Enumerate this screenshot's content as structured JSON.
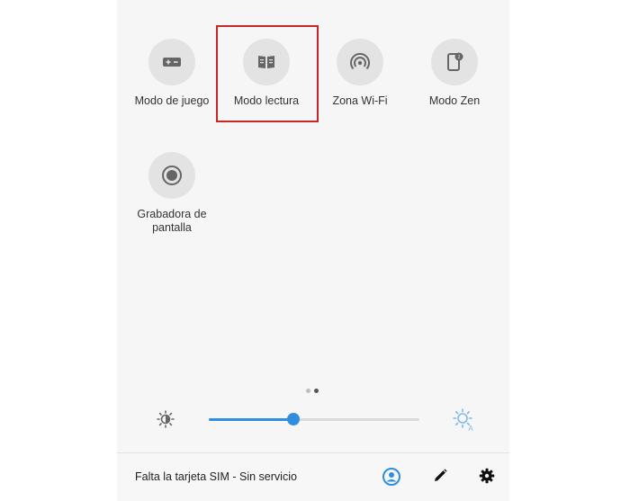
{
  "tiles_row1": [
    {
      "label": "Modo de juego",
      "icon": "gamepad-icon"
    },
    {
      "label": "Modo lectura",
      "icon": "book-icon"
    },
    {
      "label": "Zona Wi-Fi",
      "icon": "hotspot-icon"
    },
    {
      "label": "Modo Zen",
      "icon": "zen-icon"
    }
  ],
  "tiles_row2": [
    {
      "label": "Grabadora de\npantalla",
      "icon": "screen-recorder-icon"
    }
  ],
  "highlighted_tile": "Modo lectura",
  "pager": {
    "pages": 2,
    "current": 2
  },
  "brightness": {
    "value": 0.4,
    "low_icon": "brightness-low-icon",
    "auto_icon": "brightness-auto-icon"
  },
  "status_bar": {
    "text": "Falta la tarjeta SIM - Sin servicio",
    "icons": [
      "user-icon",
      "edit-icon",
      "settings-icon"
    ]
  },
  "colors": {
    "accent": "#2f8ee0",
    "highlight": "#c62828",
    "tile_bg": "#e3e3e3"
  }
}
